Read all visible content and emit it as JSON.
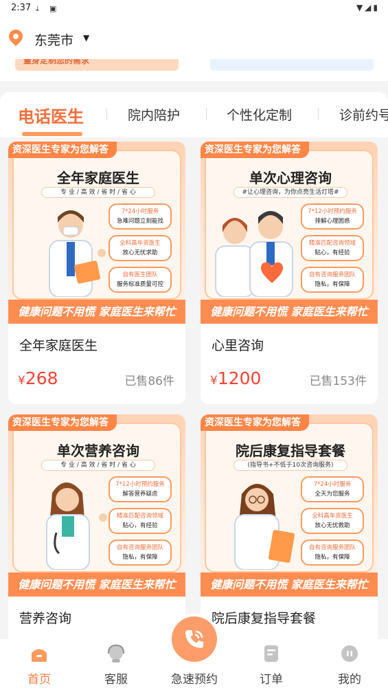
{
  "status_bar": {
    "time": "2:37"
  },
  "header": {
    "city": "东莞市"
  },
  "peek_banner": {
    "text": "量身定制您的需求"
  },
  "tabs": [
    {
      "label": "电话医生",
      "active": true
    },
    {
      "label": "院内陪护"
    },
    {
      "label": "个性化定制"
    },
    {
      "label": "诊前约号"
    }
  ],
  "products": [
    {
      "ribbon": "资深医生专家为您解答",
      "poster_title": "全年家庭医生",
      "poster_sub": "专 业 / 高 效 / 省 时 / 省 心",
      "bubbles": [
        {
          "h": "7*24小时服务",
          "t": "急难问题立刻能找"
        },
        {
          "h": "全科高年资医生",
          "t": "放心无忧求助"
        },
        {
          "h": "自有医生团队",
          "t": "服务标准质量可控"
        }
      ],
      "banner": "健康问题不用慌 家庭医生来帮忙",
      "name": "全年家庭医生",
      "currency": "¥",
      "price": "268",
      "sold": "已售86件"
    },
    {
      "ribbon": "资深医生专家为您解答",
      "poster_title": "单次心理咨询",
      "poster_sub": "#让心理咨询，为你点亮生活灯塔#",
      "bubbles": [
        {
          "h": "7*12小时预约服务",
          "t": "排解心理困惑"
        },
        {
          "h": "精准匹配咨询领域",
          "t": "贴心，有经验"
        },
        {
          "h": "自有咨询服务团队",
          "t": "隐私，有保障"
        }
      ],
      "banner": "健康问题不用慌 家庭医生来帮忙",
      "name": "心里咨询",
      "currency": "¥",
      "price": "1200",
      "sold": "已售153件"
    },
    {
      "ribbon": "资深医生专家为您解答",
      "poster_title": "单次营养咨询",
      "poster_sub": "专 业 / 高 效 / 省 时 / 省 心",
      "bubbles": [
        {
          "h": "7*12小时预约服务",
          "t": "解答营养疑虑"
        },
        {
          "h": "精准匹配咨询领域",
          "t": "贴心，有经验"
        },
        {
          "h": "自有咨询服务团队",
          "t": "隐私，有保障"
        }
      ],
      "banner": "健康问题不用慌 家庭医生来帮忙",
      "name": "营养咨询"
    },
    {
      "ribbon": "资深医生专家为您解答",
      "poster_title": "院后康复指导套餐",
      "poster_sub": "(指导书+不低于10次咨询服务)",
      "bubbles": [
        {
          "h": "7*24小时服务",
          "t": "全天为您服务"
        },
        {
          "h": "全科高年资医生",
          "t": "放心无忧救助"
        },
        {
          "h": "自有咨询服务团队",
          "t": "隐私，有保障"
        }
      ],
      "banner": "健康问题不用慌 家庭医生来帮忙",
      "name": "院后康复指导套餐"
    }
  ],
  "bottom_nav": [
    {
      "label": "首页",
      "icon": "home-icon",
      "active": true
    },
    {
      "label": "客服",
      "icon": "customer-service-icon"
    },
    {
      "label": "急速预约",
      "icon": "phone-call-icon"
    },
    {
      "label": "订单",
      "icon": "order-icon"
    },
    {
      "label": "我的",
      "icon": "profile-icon"
    }
  ],
  "colors": {
    "accent": "#f06f3c",
    "price": "#f44336",
    "poster_banner": "#ff8d52"
  }
}
